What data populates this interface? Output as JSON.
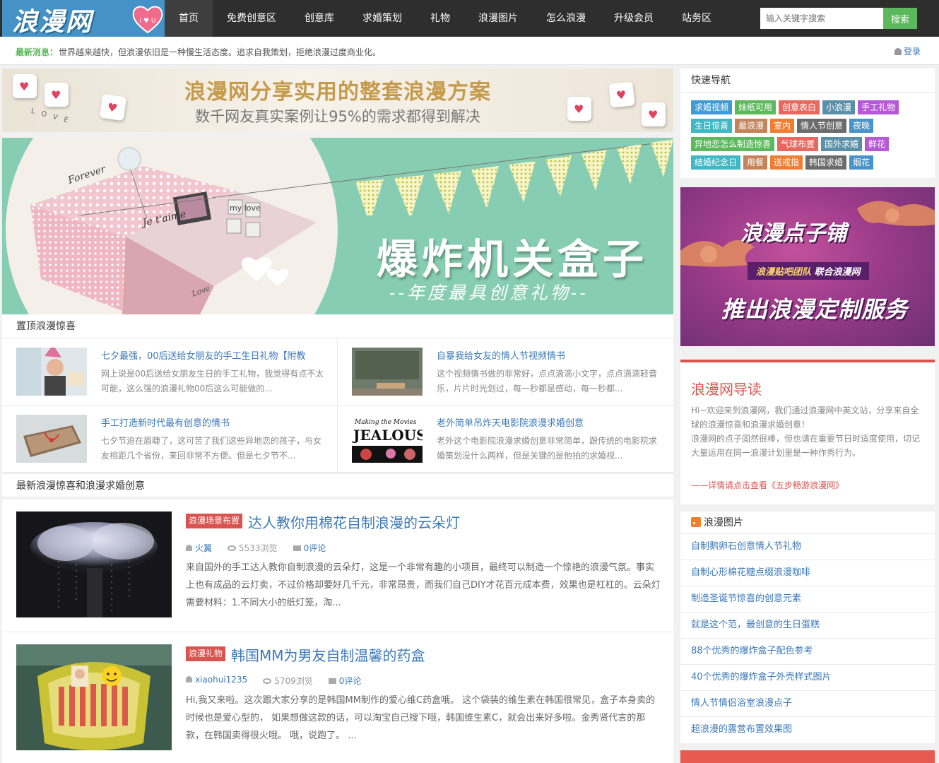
{
  "header": {
    "logo_text": "浪漫网",
    "logo_badge": "I ♥ U",
    "nav": [
      {
        "label": "首页",
        "active": true
      },
      {
        "label": "免费创意区"
      },
      {
        "label": "创意库"
      },
      {
        "label": "求婚策划"
      },
      {
        "label": "礼物"
      },
      {
        "label": "浪漫图片"
      },
      {
        "label": "怎么浪漫"
      },
      {
        "label": "升级会员"
      },
      {
        "label": "站务区"
      }
    ],
    "search_placeholder": "输入关键字搜索",
    "search_button": "搜索"
  },
  "newsbar": {
    "label": "最新消息：",
    "text": "世界越来越快，但浪漫依旧是一种慢生活态度。追求自我策划，拒绝浪漫过度商业化。",
    "login": "登录"
  },
  "banner1": {
    "title": "浪漫网分享实用的整套浪漫方案",
    "subtitle": "数千网友真实案例让95%的需求都得到解决",
    "decor_text": "L O V E"
  },
  "banner2": {
    "title": "爆炸机关盒子",
    "subtitle": "--年度最具创意礼物--",
    "box_texts": [
      "Forever",
      "my love",
      "Je t'aime",
      "Love"
    ]
  },
  "pinned": {
    "heading": "置顶浪漫惊喜",
    "items": [
      {
        "title": "七夕最强，00后送给女朋友的手工生日礼物【附教",
        "desc": "网上说是00后送给女朋友生日的手工礼物，我觉得有点不太可能，这么强的浪漫礼物00后这么可能做的..."
      },
      {
        "title": "自暴我给女友的情人节视频情书",
        "desc": "这个视频情书做的非常好，点点滴滴小文字，点点滴滴轻音乐，片片时光划过，每一秒都是感动，每一秒都..."
      },
      {
        "title": "手工打造新时代最有创意的情书",
        "desc": "七夕节迫在眉睫了，这可苦了我们这些异地恋的孩子，与女友相距几个省份，来回非常不方便。但是七夕节不..."
      },
      {
        "title": "老外简单吊炸天电影院浪漫求婚创意",
        "desc": "老外这个电影院浪漫求婚创意非常简单，跟传统的电影院求婚策划没什么两样，但是关键的是他拍的求婚视..."
      }
    ],
    "thumb_text": {
      "movie_top": "Making the Movies",
      "movie_main": "JEALOUS"
    }
  },
  "latest": {
    "heading": "最新浪漫惊喜和浪漫求婚创意",
    "articles": [
      {
        "tag": "浪漫场景布置",
        "title": "达人教你用棉花自制浪漫的云朵灯",
        "author": "火翼",
        "views": "5533浏览",
        "comments": "0评论",
        "desc": "来自国外的手工达人教你自制浪漫的云朵灯，这是一个非常有趣的小项目，最终可以制造一个惊艳的浪漫气氛。事实上也有成品的云灯卖，不过价格却要好几千元，非常昂贵，而我们自己DIY才花百元成本费，效果也是杠杠的。云朵灯需要材料：1.不同大小的纸灯笼，淘..."
      },
      {
        "tag": "浪漫礼物",
        "title": "韩国MM为男友自制温馨的药盒",
        "author": "xiaohui1235",
        "views": "5709浏览",
        "comments": "0评论",
        "desc": "Hi,我又来啦。这次跟大家分享的是韩国MM制作的爱心维C药盒哦。 这个袋装的维生素在韩国很常见，盒子本身卖的时候也是爱心型的， 如果想做这款的话，可以淘宝自己搜下哦，韩国维生素C，就会出来好多啦。金秀贤代言的那款，在韩国卖得很火哦。 哦，说跑了。 ..."
      }
    ]
  },
  "sidebar": {
    "quicknav_title": "快速导航",
    "tags": [
      {
        "label": "求婚视频",
        "color": "#3e9bd6"
      },
      {
        "label": "妹纸可用",
        "color": "#5cb85c"
      },
      {
        "label": "创意表白",
        "color": "#e8685f"
      },
      {
        "label": "小浪漫",
        "color": "#5b8fa8"
      },
      {
        "label": "手工礼物",
        "color": "#b659d6"
      },
      {
        "label": "生日惊喜",
        "color": "#3eb8c4"
      },
      {
        "label": "最浪漫",
        "color": "#c3845a"
      },
      {
        "label": "室内",
        "color": "#f07d31"
      },
      {
        "label": "情人节创意",
        "color": "#6b6b6b"
      },
      {
        "label": "夜晚",
        "color": "#4a93c9"
      },
      {
        "label": "异地恋怎么制造惊喜",
        "color": "#5cb85c"
      },
      {
        "label": "气球布置",
        "color": "#e8685f"
      },
      {
        "label": "国外求婚",
        "color": "#5b8fa8"
      },
      {
        "label": "鲜花",
        "color": "#b659d6"
      },
      {
        "label": "结婚纪念日",
        "color": "#3eb8c4"
      },
      {
        "label": "用餐",
        "color": "#c3845a"
      },
      {
        "label": "送戒指",
        "color": "#f07d31"
      },
      {
        "label": "韩国求婚",
        "color": "#6b6b6b"
      },
      {
        "label": "烟花",
        "color": "#4a93c9"
      }
    ],
    "ad": {
      "title": "浪漫点子铺",
      "team": "浪漫贴吧团队",
      "team_suffix": "联合浪漫网",
      "tagline": "推出浪漫定制服务"
    },
    "guide": {
      "title": "浪漫网导读",
      "text": "Hi~欢迎来到浪漫网，我们通过浪漫网中英文站，分享来自全球的浪漫惊喜和浪漫求婚创意！\n浪漫网的点子固然很棒，但也请在重要节日时适度使用，切记大量运用在同一浪漫计划里是一种作秀行为。",
      "link": "——详情请点击查看《五步畅游浪漫网》"
    },
    "pics": {
      "title": "浪漫图片",
      "items": [
        "自制鹅卵石创意情人节礼物",
        "自制心形棉花糖点缀浪漫咖啡",
        "制造圣诞节惊喜的创意元素",
        "就是这个范，最创意的生日蛋糕",
        "88个优秀的爆炸盒子配色参考",
        "40个优秀的爆炸盒子外壳样式图片",
        "情人节情侣浴室浪漫点子",
        "超浪漫的露营布置效果图"
      ]
    }
  }
}
